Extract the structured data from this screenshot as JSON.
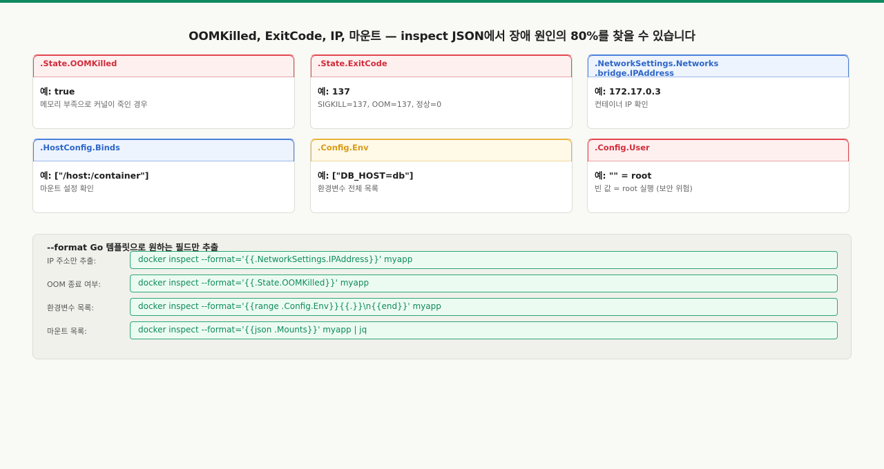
{
  "title": "OOMKilled, ExitCode, IP, 마운트 — inspect JSON에서 장애 원인의 80%를 찾을 수 있습니다",
  "colors": {
    "accent": "#0f8a5f",
    "red": "#d12d3a",
    "blue": "#2e66c8",
    "amber": "#d99b14"
  },
  "cards": [
    {
      "key": ".State.OOMKilled",
      "example": "예: true",
      "desc": "메모리 부족으로 커널이 죽인 경우",
      "color": "red"
    },
    {
      "key": ".State.ExitCode",
      "example": "예: 137",
      "desc": "SIGKILL=137, OOM=137, 정상=0",
      "color": "red"
    },
    {
      "key": ".NetworkSettings.Networks\n.bridge.IPAddress",
      "example": "예: 172.17.0.3",
      "desc": "컨테이너 IP 확인",
      "color": "blue"
    },
    {
      "key": ".HostConfig.Binds",
      "example": "예: [\"/host:/container\"]",
      "desc": "마운트 설정 확인",
      "color": "blue"
    },
    {
      "key": ".Config.Env",
      "example": "예: [\"DB_HOST=db\"]",
      "desc": "환경변수 전체 목록",
      "color": "amber"
    },
    {
      "key": ".Config.User",
      "example": "예: \"\" = root",
      "desc": "빈 값 = root 실행 (보안 위험)",
      "color": "red"
    }
  ],
  "format_panel": {
    "title": "--format Go 템플릿으로 원하는 필드만 추출",
    "rows": [
      {
        "label": "IP 주소만 추출:",
        "command": "docker inspect --format='{{.NetworkSettings.IPAddress}}' myapp"
      },
      {
        "label": "OOM 종료 여부:",
        "command": "docker inspect --format='{{.State.OOMKilled}}' myapp"
      },
      {
        "label": "환경변수 목록:",
        "command": "docker inspect --format='{{range .Config.Env}}{{.}}\\n{{end}}' myapp"
      },
      {
        "label": "마운트 목록:",
        "command": "docker inspect --format='{{json .Mounts}}' myapp | jq"
      }
    ]
  }
}
